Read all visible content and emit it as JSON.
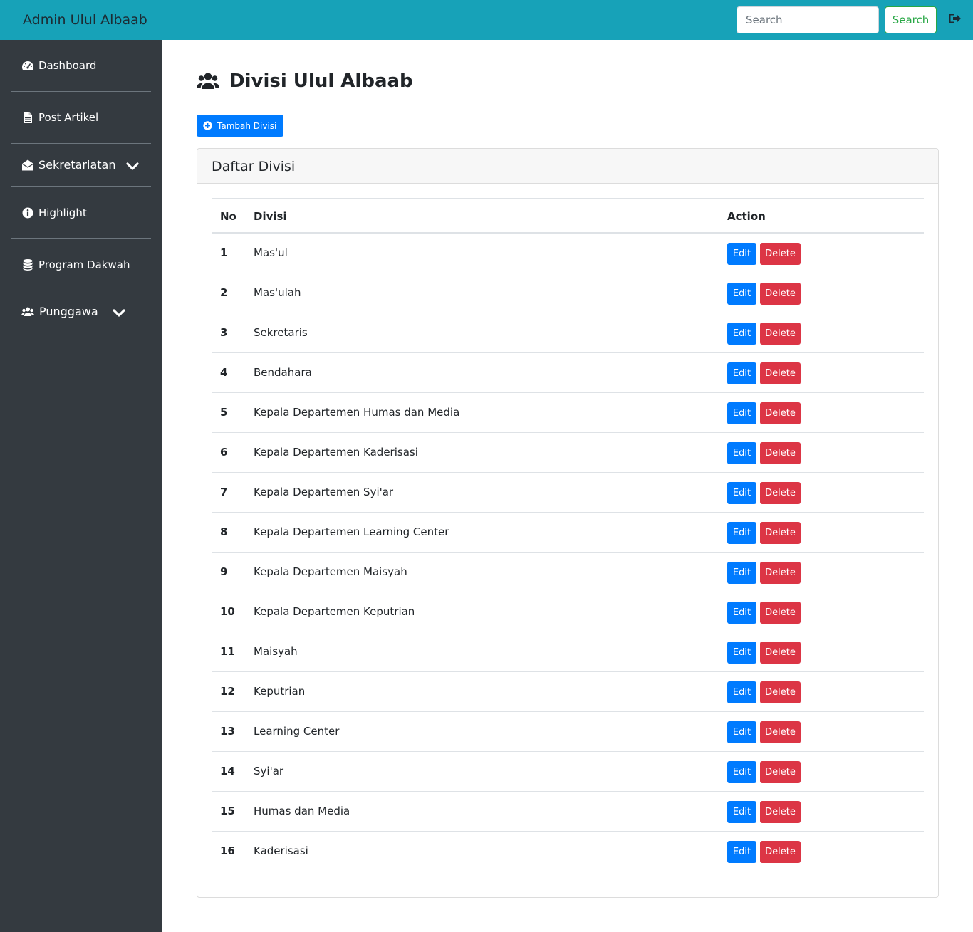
{
  "header": {
    "brand": "Admin Ulul Albaab",
    "search_placeholder": "Search",
    "search_button": "Search",
    "logout_icon": "sign-out-icon"
  },
  "sidebar": {
    "items": [
      {
        "label": "Dashboard",
        "icon": "tachometer-icon"
      },
      {
        "label": "Post Artikel",
        "icon": "file-icon"
      },
      {
        "label": "Sekretariatan",
        "icon": "envelope-open-icon",
        "has_dropdown": true
      },
      {
        "label": "Highlight",
        "icon": "info-circle-icon"
      },
      {
        "label": "Program Dakwah",
        "icon": "database-icon"
      },
      {
        "label": "Punggawa",
        "icon": "users-icon",
        "has_dropdown": true
      }
    ]
  },
  "main": {
    "title": "Divisi Ulul Albaab",
    "title_icon": "users-icon",
    "add_button": "Tambah Divisi",
    "card_title": "Daftar Divisi",
    "columns": [
      "No",
      "Divisi",
      "Action"
    ],
    "edit_label": "Edit",
    "delete_label": "Delete",
    "rows": [
      {
        "no": "1",
        "divisi": "Mas'ul"
      },
      {
        "no": "2",
        "divisi": "Mas'ulah"
      },
      {
        "no": "3",
        "divisi": "Sekretaris"
      },
      {
        "no": "4",
        "divisi": "Bendahara"
      },
      {
        "no": "5",
        "divisi": "Kepala Departemen Humas dan Media"
      },
      {
        "no": "6",
        "divisi": "Kepala Departemen Kaderisasi"
      },
      {
        "no": "7",
        "divisi": "Kepala Departemen Syi'ar"
      },
      {
        "no": "8",
        "divisi": "Kepala Departemen Learning Center"
      },
      {
        "no": "9",
        "divisi": "Kepala Departemen Maisyah"
      },
      {
        "no": "10",
        "divisi": "Kepala Departemen Keputrian"
      },
      {
        "no": "11",
        "divisi": "Maisyah"
      },
      {
        "no": "12",
        "divisi": "Keputrian"
      },
      {
        "no": "13",
        "divisi": "Learning Center"
      },
      {
        "no": "14",
        "divisi": "Syi'ar"
      },
      {
        "no": "15",
        "divisi": "Humas dan Media"
      },
      {
        "no": "16",
        "divisi": "Kaderisasi"
      }
    ]
  },
  "colors": {
    "topbar": "#17a2b8",
    "sidebar": "#343a40",
    "primary": "#007bff",
    "danger": "#dc3545",
    "success": "#28a745"
  }
}
